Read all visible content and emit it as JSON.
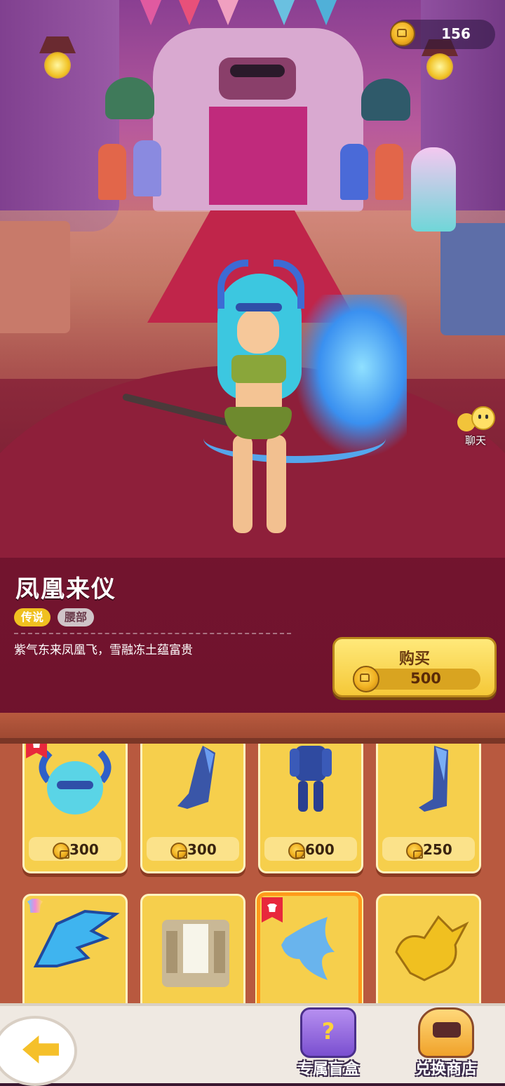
{
  "currency": {
    "icon": "gold-coin-icon",
    "amount": "156"
  },
  "chat": {
    "label": "聊天"
  },
  "item": {
    "name": "凤凰来仪",
    "rarity": "传说",
    "slot": "腰部",
    "description": "紫气东来凤凰飞，雪融冻土蕴富贵"
  },
  "buy": {
    "label": "购买",
    "price": "500"
  },
  "shop": {
    "items": [
      {
        "icon": "horned-blue-helmet",
        "price": "300"
      },
      {
        "icon": "blue-armored-boot",
        "price": "300"
      },
      {
        "icon": "blue-armor-suit",
        "price": "600"
      },
      {
        "icon": "blue-tall-boot",
        "price": "250"
      },
      {
        "icon": "blue-dragon-wings",
        "price": ""
      },
      {
        "icon": "temple-background",
        "price": ""
      },
      {
        "icon": "blue-phoenix",
        "price": ""
      },
      {
        "icon": "golden-dragon",
        "price": ""
      }
    ]
  },
  "nav": {
    "blind_box": "专属盲盒",
    "exchange_shop": "兑换商店"
  },
  "colors": {
    "accent": "#f5c838",
    "legend": "#f0c020"
  }
}
